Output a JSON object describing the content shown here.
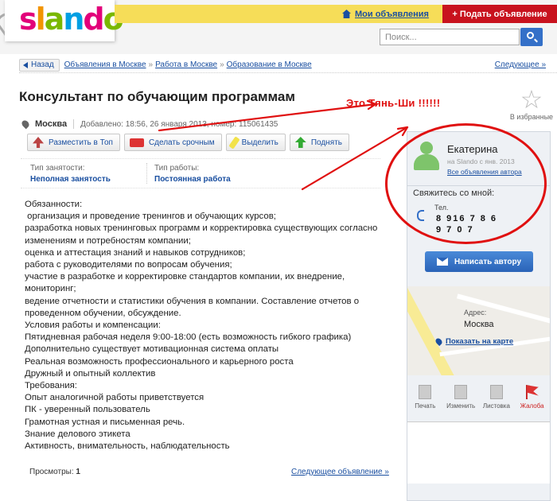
{
  "header": {
    "logo": {
      "s": "s",
      "l": "l",
      "a": "a",
      "n": "n",
      "d": "d",
      "o": "o"
    },
    "my_ads_label": "Мои объявления",
    "post_ad_label": "+ Подать объявление",
    "search_placeholder": "Поиск..."
  },
  "breadcrumbs": {
    "back_label": "Назад",
    "items": [
      "Объявления в Москве",
      "Работа в Москве",
      "Образование в Москве"
    ],
    "separator": "»",
    "next_label": "Следующее »"
  },
  "ad": {
    "title": "Консультант по обучающим программам",
    "city": "Москва",
    "added": "Добавлено: 18:56, 26 января 2013, номер: 115061435",
    "favorite_label": "В избранные",
    "actions": [
      "Разместить в Топ",
      "Сделать срочным",
      "Выделить",
      "Поднять"
    ],
    "props": [
      {
        "label": "Тип занятости:",
        "value": "Неполная занятость"
      },
      {
        "label": "Тип работы:",
        "value": "Постоянная работа"
      }
    ],
    "description": [
      "Обязанности:",
      " организация и проведение тренингов и обучающих курсов;",
      "разработка новых тренинговых программ и корректировка существующих согласно изменениям и потребностям компании;",
      "оценка и аттестация знаний и навыков сотрудников;",
      "работа с руководителями по вопросам обучения;",
      "участие в разработке и корректировке стандартов компании, их внедрение, мониторинг;",
      "ведение отчетности и статистики обучения в компании. Составление отчетов о проведенном обучении, обсуждение.",
      "Условия работы и компенсации:",
      "Пятидневная рабочая неделя 9:00-18:00 (есть возможность гибкого графика)",
      "Дополнительно существует мотивационная система оплаты",
      "Реальная возможность профессионального и карьерного роста",
      "Дружный и опытный коллектив",
      "Требования:",
      "Опыт аналогичной работы приветствуется",
      "ПК - уверенный пользователь",
      "Грамотная устная и письменная речь.",
      "Знание делового этикета",
      "Активность, внимательность, наблюдательность"
    ],
    "views_label": "Просмотры:",
    "views_count": "1",
    "next_ad_label": "Следующее объявление »"
  },
  "seller": {
    "name": "Екатерина",
    "since": "на Slando с янв. 2013",
    "all_ads_label": "Все объявления автора",
    "contact_header": "Свяжитесь со мной:",
    "phone_label": "Тел.",
    "phone": "8 916 7 8 6 9 7 0 7",
    "write_label": "Написать автору",
    "address_label": "Адрес:",
    "address": "Москва",
    "map_link": "Показать на карте",
    "tools": [
      "Печать",
      "Изменить",
      "Листовка",
      "Жалоба"
    ]
  },
  "annotation": {
    "text": "Это Тянь-Ши !!!!!!",
    "color": "#e01010"
  }
}
